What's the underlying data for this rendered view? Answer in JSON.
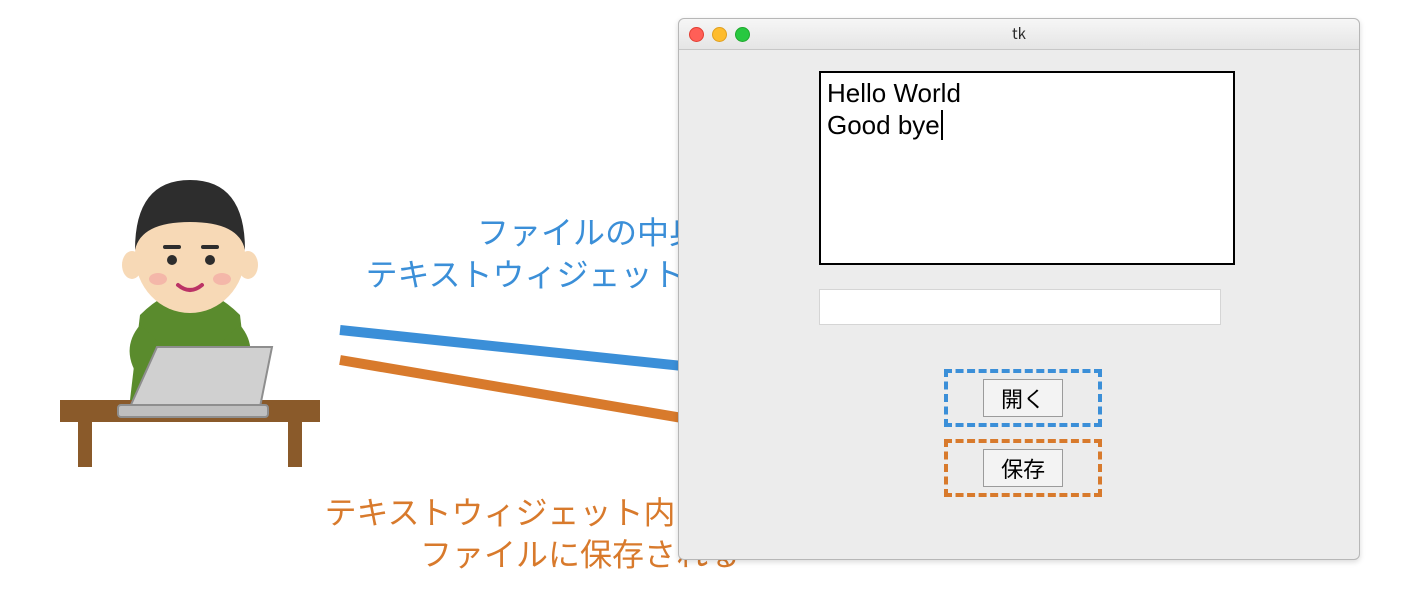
{
  "window": {
    "title": "tk",
    "text_widget": {
      "line1": "Hello World",
      "line2": "Good bye"
    },
    "open_button_label": "開く",
    "save_button_label": "保存"
  },
  "annotations": {
    "blue_line1": "ファイルの中身が",
    "blue_line2": "テキストウィジェットに表示れる",
    "orange_line1": "テキストウィジェット内の文字列が",
    "orange_line2": "ファイルに保存される"
  },
  "colors": {
    "blue": "#3b8fd8",
    "orange": "#d87a2c"
  }
}
